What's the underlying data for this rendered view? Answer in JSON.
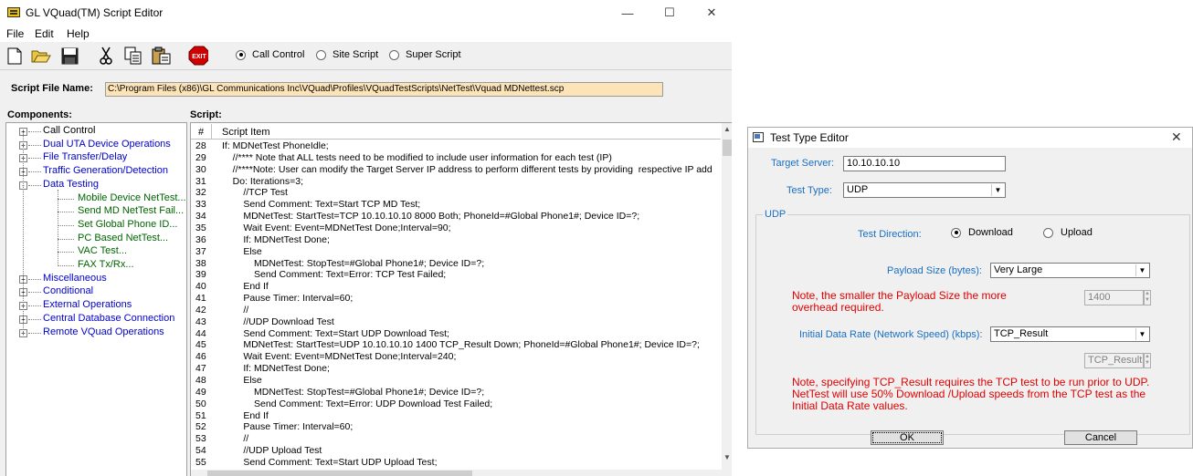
{
  "main": {
    "title": "GL VQuad(TM) Script Editor",
    "caption": {
      "minimize": "—",
      "maximize": "☐",
      "close": "✕"
    },
    "menu": [
      "File",
      "Edit",
      "Help"
    ],
    "toolbar": {
      "exit_label": "EXIT",
      "modes": [
        {
          "label": "Call Control",
          "selected": true
        },
        {
          "label": "Site Script",
          "selected": false
        },
        {
          "label": "Super Script",
          "selected": false
        }
      ]
    },
    "script_file": {
      "label": "Script File Name:",
      "value": "C:\\Program Files (x86)\\GL Communications Inc\\VQuad\\Profiles\\VQuadTestScripts\\NetTest\\Vquad MDNettest.scp"
    },
    "components_label": "Components:",
    "script_label": "Script:",
    "tree": [
      {
        "label": "Call Control",
        "level": 0,
        "expander": "+",
        "color": "#000000"
      },
      {
        "label": "Dual UTA Device Operations",
        "level": 0,
        "expander": "+",
        "color": "#0000cc"
      },
      {
        "label": "File Transfer/Delay",
        "level": 0,
        "expander": "+",
        "color": "#0000cc"
      },
      {
        "label": "Traffic Generation/Detection",
        "level": 0,
        "expander": "+",
        "color": "#0000cc"
      },
      {
        "label": "Data Testing",
        "level": 0,
        "expander": "-",
        "color": "#0000cc"
      },
      {
        "label": "Mobile Device NetTest...",
        "level": 1,
        "color": "#006400"
      },
      {
        "label": "Send MD NetTest Fail...",
        "level": 1,
        "color": "#006400"
      },
      {
        "label": "Set Global Phone ID...",
        "level": 1,
        "color": "#006400"
      },
      {
        "label": "PC Based NetTest...",
        "level": 1,
        "color": "#006400"
      },
      {
        "label": "VAC Test...",
        "level": 1,
        "color": "#006400"
      },
      {
        "label": "FAX Tx/Rx...",
        "level": 1,
        "color": "#006400"
      },
      {
        "label": "Miscellaneous",
        "level": 0,
        "expander": "+",
        "color": "#0000cc"
      },
      {
        "label": "Conditional",
        "level": 0,
        "expander": "+",
        "color": "#0000cc"
      },
      {
        "label": "External Operations",
        "level": 0,
        "expander": "+",
        "color": "#0000cc"
      },
      {
        "label": "Central Database Connection",
        "level": 0,
        "expander": "+",
        "color": "#0000cc"
      },
      {
        "label": "Remote VQuad Operations",
        "level": 0,
        "expander": "+",
        "color": "#0000cc"
      }
    ],
    "script_header": {
      "num": "#",
      "item": "Script Item"
    },
    "script_rows": [
      {
        "n": "28",
        "t": "If: MDNetTest PhoneIdle;"
      },
      {
        "n": "29",
        "t": "    //**** Note that ALL tests need to be modified to include user information for each test (IP)"
      },
      {
        "n": "30",
        "t": "    //****Note: User can modify the Target Server IP address to perform different tests by providing  respective IP add"
      },
      {
        "n": "31",
        "t": "    Do: Iterations=3;"
      },
      {
        "n": "32",
        "t": "        //TCP Test"
      },
      {
        "n": "33",
        "t": "        Send Comment: Text=Start TCP MD Test;"
      },
      {
        "n": "34",
        "t": "        MDNetTest: StartTest=TCP 10.10.10.10 8000 Both; PhoneId=#Global Phone1#; Device ID=?;"
      },
      {
        "n": "35",
        "t": "        Wait Event: Event=MDNetTest Done;Interval=90;"
      },
      {
        "n": "36",
        "t": "        If: MDNetTest Done;"
      },
      {
        "n": "37",
        "t": "        Else"
      },
      {
        "n": "38",
        "t": "            MDNetTest: StopTest=#Global Phone1#; Device ID=?;"
      },
      {
        "n": "39",
        "t": "            Send Comment: Text=Error: TCP Test Failed;"
      },
      {
        "n": "40",
        "t": "        End If"
      },
      {
        "n": "41",
        "t": "        Pause Timer: Interval=60;"
      },
      {
        "n": "42",
        "t": "        //"
      },
      {
        "n": "43",
        "t": "        //UDP Download Test"
      },
      {
        "n": "44",
        "t": "        Send Comment: Text=Start UDP Download Test;"
      },
      {
        "n": "45",
        "t": "        MDNetTest: StartTest=UDP 10.10.10.10 1400 TCP_Result Down; PhoneId=#Global Phone1#; Device ID=?;"
      },
      {
        "n": "46",
        "t": "        Wait Event: Event=MDNetTest Done;Interval=240;"
      },
      {
        "n": "47",
        "t": "        If: MDNetTest Done;"
      },
      {
        "n": "48",
        "t": "        Else"
      },
      {
        "n": "49",
        "t": "            MDNetTest: StopTest=#Global Phone1#; Device ID=?;"
      },
      {
        "n": "50",
        "t": "            Send Comment: Text=Error: UDP Download Test Failed;"
      },
      {
        "n": "51",
        "t": "        End If"
      },
      {
        "n": "52",
        "t": "        Pause Timer: Interval=60;"
      },
      {
        "n": "53",
        "t": "        //"
      },
      {
        "n": "54",
        "t": "        //UDP Upload Test"
      },
      {
        "n": "55",
        "t": "        Send Comment: Text=Start UDP Upload Test;"
      }
    ]
  },
  "dialog": {
    "title": "Test Type Editor",
    "close": "✕",
    "target_server_label": "Target Server:",
    "target_server_value": "10.10.10.10",
    "test_type_label": "Test Type:",
    "test_type_value": "UDP",
    "group_label": "UDP",
    "direction_label": "Test Direction:",
    "direction_options": [
      {
        "label": "Download",
        "selected": true
      },
      {
        "label": "Upload",
        "selected": false
      }
    ],
    "payload_label": "Payload Size (bytes):",
    "payload_value": "Very Large",
    "payload_note": "Note, the smaller the Payload Size the more overhead required.",
    "payload_spin_value": "1400",
    "rate_label": "Initial Data Rate (Network Speed) (kbps):",
    "rate_value": "TCP_Result",
    "rate_spin_value": "TCP_Result",
    "rate_note": "Note, specifying TCP_Result requires the TCP test to be run prior to UDP. NetTest will use 50% Download /Upload speeds from the TCP test as the Initial Data Rate values.",
    "ok_label": "OK",
    "cancel_label": "Cancel"
  }
}
